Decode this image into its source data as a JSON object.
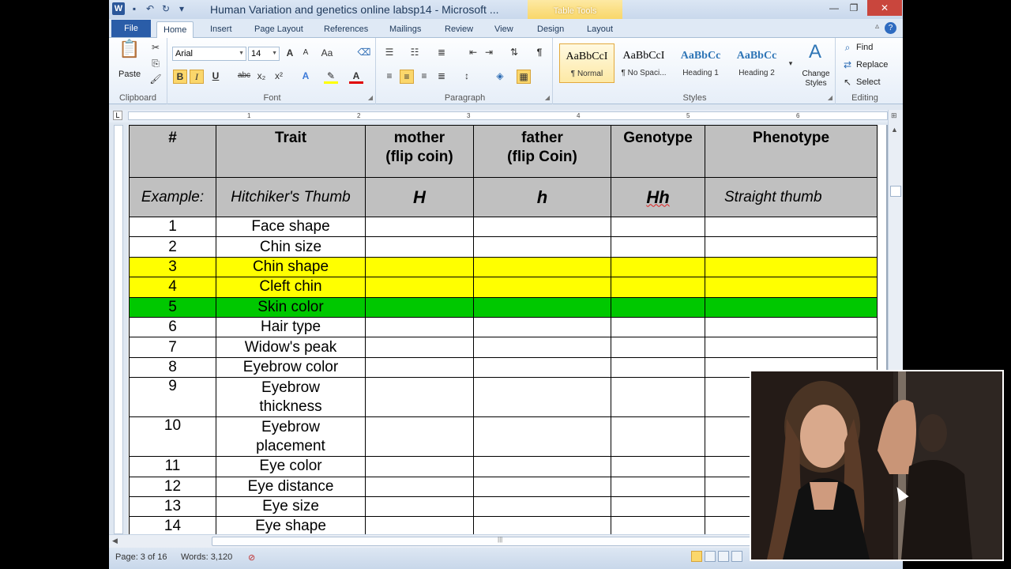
{
  "window": {
    "title": "Human Variation and genetics online labsp14  -  Microsoft ...",
    "contextual_tab": "Table Tools"
  },
  "tabs": [
    "File",
    "Home",
    "Insert",
    "Page Layout",
    "References",
    "Mailings",
    "Review",
    "View",
    "Design",
    "Layout"
  ],
  "ribbon": {
    "clipboard": {
      "label": "Clipboard",
      "paste": "Paste"
    },
    "font": {
      "label": "Font",
      "font_name": "Arial",
      "font_size": "14",
      "bold": "B",
      "italic": "I",
      "underline": "U",
      "strike": "abc",
      "sub": "x₂",
      "sup": "x²",
      "grow": "A",
      "shrink": "A",
      "case": "Aa"
    },
    "paragraph": {
      "label": "Paragraph",
      "pilcrow": "¶"
    },
    "styles": {
      "label": "Styles",
      "items": [
        {
          "sample": "AaBbCcI",
          "name": "¶ Normal"
        },
        {
          "sample": "AaBbCcI",
          "name": "¶ No Spaci..."
        },
        {
          "sample": "AaBbCc",
          "name": "Heading 1"
        },
        {
          "sample": "AaBbCc",
          "name": "Heading 2"
        }
      ],
      "change_styles": "Change Styles"
    },
    "editing": {
      "label": "Editing",
      "find": "Find",
      "replace": "Replace",
      "select": "Select"
    }
  },
  "ruler": {
    "numbers": [
      "1",
      "2",
      "3",
      "4",
      "5",
      "6"
    ]
  },
  "table": {
    "header": [
      "#",
      "Trait",
      "mother\n(flip coin)",
      "father\n(flip Coin)",
      "Genotype",
      "Phenotype"
    ],
    "example": [
      "Example:",
      "Hitchiker's Thumb",
      "H",
      "h",
      "Hh",
      "Straight thumb"
    ],
    "rows": [
      {
        "num": "1",
        "trait": "Face shape",
        "hl": ""
      },
      {
        "num": "2",
        "trait": "Chin size",
        "hl": ""
      },
      {
        "num": "3",
        "trait": "Chin shape",
        "hl": "yellow"
      },
      {
        "num": "4",
        "trait": "Cleft chin",
        "hl": "yellow"
      },
      {
        "num": "5",
        "trait": "Skin color",
        "hl": "green"
      },
      {
        "num": "6",
        "trait": "Hair type",
        "hl": ""
      },
      {
        "num": "7",
        "trait": "Widow's peak",
        "hl": ""
      },
      {
        "num": "8",
        "trait": "Eyebrow color",
        "hl": ""
      },
      {
        "num": "9",
        "trait": "Eyebrow thickness",
        "hl": ""
      },
      {
        "num": "10",
        "trait": "Eyebrow placement",
        "hl": ""
      },
      {
        "num": "11",
        "trait": "Eye color",
        "hl": ""
      },
      {
        "num": "12",
        "trait": "Eye distance",
        "hl": ""
      },
      {
        "num": "13",
        "trait": "Eye size",
        "hl": ""
      },
      {
        "num": "14",
        "trait": "Eye shape",
        "hl": ""
      }
    ]
  },
  "status": {
    "page": "Page: 3 of 16",
    "words": "Words: 3,120"
  },
  "colors": {
    "highlight_yellow": "#ffff00",
    "highlight_green": "#00c800",
    "header_gray": "#c0c0c0"
  }
}
